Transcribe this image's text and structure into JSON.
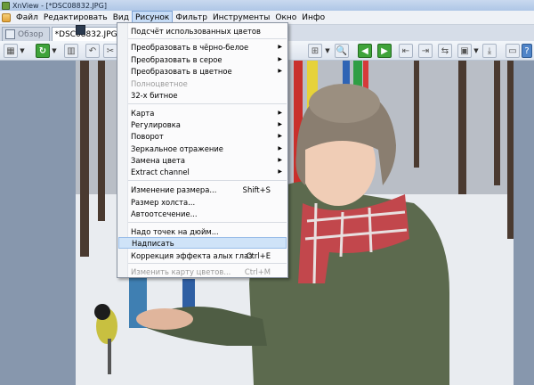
{
  "window": {
    "title": "XnView - [*DSC08832.JPG]"
  },
  "menubar": {
    "items": [
      {
        "label": "Файл"
      },
      {
        "label": "Редактировать"
      },
      {
        "label": "Вид"
      },
      {
        "label": "Рисунок",
        "active": true
      },
      {
        "label": "Фильтр"
      },
      {
        "label": "Инструменты"
      },
      {
        "label": "Окно"
      },
      {
        "label": "Инфо"
      }
    ]
  },
  "tabs": [
    {
      "label": "Обзор",
      "active": false
    },
    {
      "label": "*DSC08832.JPG",
      "active": true
    }
  ],
  "menu": {
    "items": [
      {
        "label": "Подсчёт использованных цветов"
      },
      {
        "label": "Преобразовать в чёрно-белое",
        "submenu": true
      },
      {
        "label": "Преобразовать в серое",
        "submenu": true
      },
      {
        "label": "Преобразовать в цветное",
        "submenu": true
      },
      {
        "label": "Полноцветное",
        "disabled": true
      },
      {
        "label": "32-х битное"
      },
      {
        "label": "Карта",
        "submenu": true
      },
      {
        "label": "Регулировка",
        "submenu": true
      },
      {
        "label": "Поворот",
        "submenu": true
      },
      {
        "label": "Зеркальное отражение",
        "submenu": true
      },
      {
        "label": "Замена цвета",
        "submenu": true
      },
      {
        "label": "Extract channel",
        "submenu": true
      },
      {
        "label": "Изменение размера...",
        "shortcut": "Shift+S"
      },
      {
        "label": "Размер холста..."
      },
      {
        "label": "Автоотсечение..."
      },
      {
        "label": "Надо точек на дюйм..."
      },
      {
        "label": "Надписать",
        "highlighted": true
      },
      {
        "label": "Коррекция эффекта алых глаз",
        "shortcut": "Ctrl+E"
      },
      {
        "label": "Изменить карту цветов...",
        "shortcut": "Ctrl+M",
        "disabled": true
      }
    ]
  }
}
